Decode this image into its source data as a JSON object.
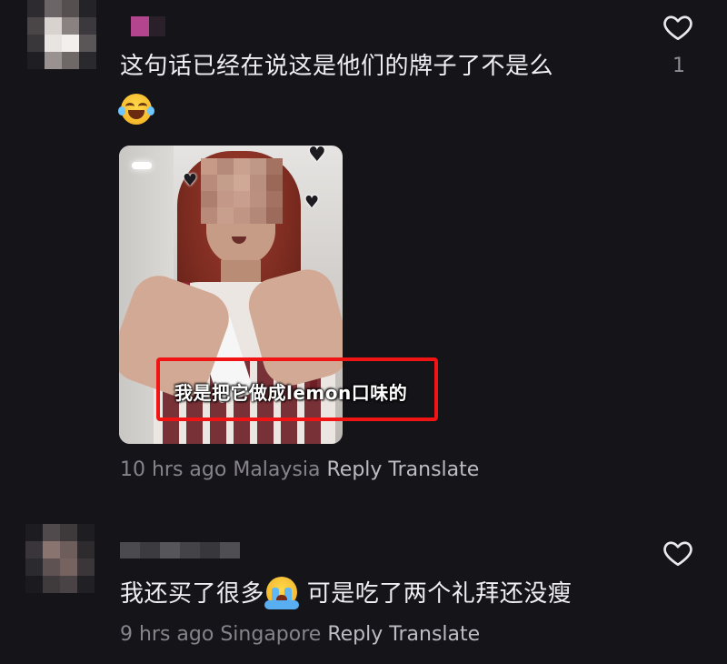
{
  "comments": [
    {
      "text": "这句话已经在说这是他们的牌子了不是么",
      "emoji": "laughing-with-tears",
      "likes": "1",
      "attachment": {
        "type": "video-frame",
        "caption": "我是把它做成lemon口味的",
        "highlight_color": "#f01414"
      },
      "time": "10 hrs ago",
      "location": "Malaysia",
      "reply_label": "Reply",
      "translate_label": "Translate"
    },
    {
      "text_before": "我还买了很多",
      "emoji": "loudly-crying",
      "text_after": " 可是吃了两个礼拜还没瘦",
      "time": "9 hrs ago",
      "location": "Singapore",
      "reply_label": "Reply",
      "translate_label": "Translate"
    }
  ],
  "icons": {
    "like": "heart-outline-icon"
  },
  "colors": {
    "background": "#151419",
    "text": "#efeef1",
    "meta": "#85848a",
    "highlight": "#f01414"
  }
}
